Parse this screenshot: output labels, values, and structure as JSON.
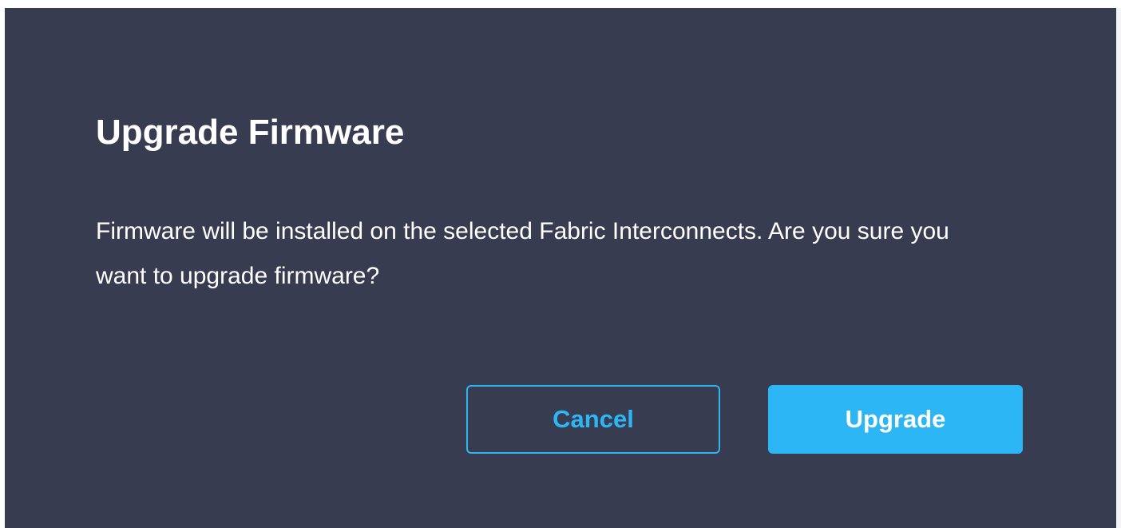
{
  "dialog": {
    "title": "Upgrade Firmware",
    "message": "Firmware will be installed on the selected Fabric Interconnects. Are you sure you want to upgrade firmware?",
    "buttons": {
      "cancel_label": "Cancel",
      "upgrade_label": "Upgrade"
    }
  },
  "colors": {
    "dialog_background": "#383c51",
    "accent": "#2db6f5",
    "text": "#ffffff"
  }
}
